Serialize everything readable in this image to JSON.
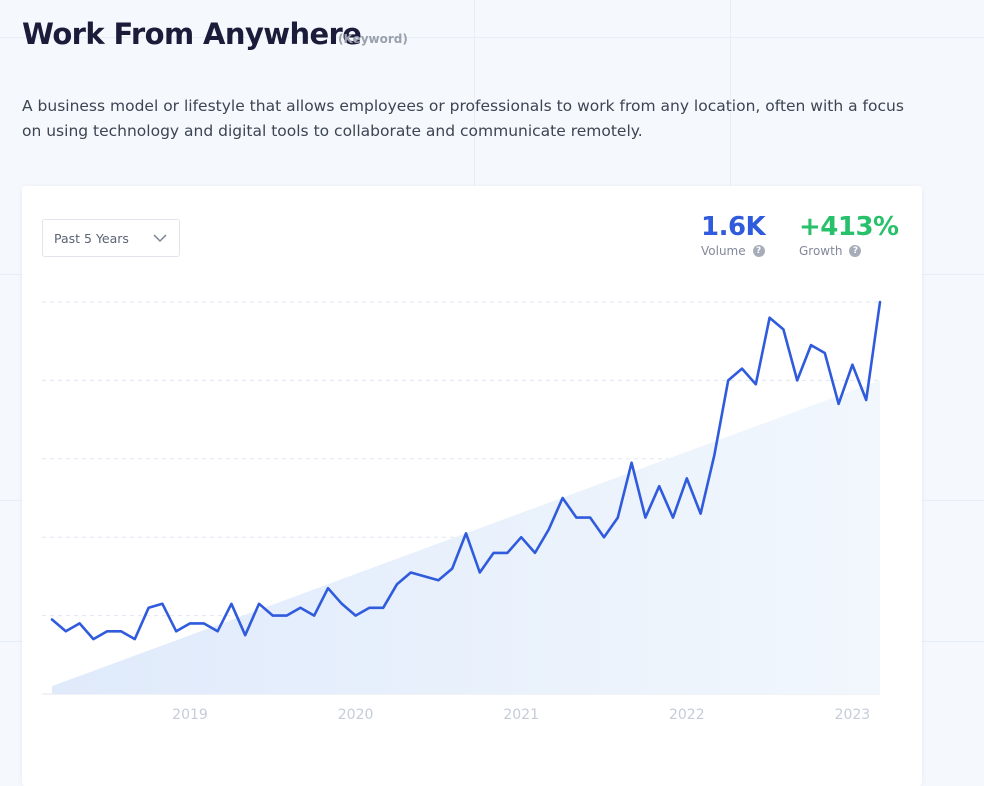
{
  "header": {
    "title": "Work From Anywhere",
    "tag": "(Keyword)",
    "description": "A business model or lifestyle that allows employees or professionals to work from any location, often with a focus on using technology and digital tools to collaborate and communicate remotely."
  },
  "controls": {
    "time_range": "Past 5 Years"
  },
  "metrics": {
    "volume": {
      "value": "1.6K",
      "label": "Volume",
      "help_icon": "question-icon",
      "color": "#2f5bdc"
    },
    "growth": {
      "value": "+413%",
      "label": "Growth",
      "help_icon": "question-icon",
      "color": "#27c06b"
    }
  },
  "chart_data": {
    "type": "line",
    "x_tick_labels": [
      "2019",
      "2020",
      "2021",
      "2022",
      "2023"
    ],
    "y_ticks": [
      0,
      20,
      40,
      60,
      80,
      100
    ],
    "ylim": [
      0,
      100
    ],
    "grid": "horizontal-dashed",
    "x_start": 2018.167,
    "x_step_months": 1,
    "series": [
      {
        "color": "#2f5bdc",
        "values": [
          19,
          16,
          18,
          14,
          16,
          16,
          14,
          22,
          23,
          16,
          18,
          18,
          16,
          23,
          15,
          23,
          20,
          20,
          22,
          20,
          27,
          23,
          20,
          22,
          22,
          28,
          31,
          30,
          29,
          32,
          41,
          31,
          36,
          36,
          40,
          36,
          42,
          50,
          45,
          45,
          40,
          45,
          59,
          45,
          53,
          45,
          55,
          46,
          61,
          80,
          83,
          79,
          96,
          93,
          80,
          89,
          87,
          74,
          84,
          75,
          100
        ]
      }
    ],
    "trend": {
      "color": "#e5f0fc",
      "start": 2,
      "end": 80
    }
  }
}
